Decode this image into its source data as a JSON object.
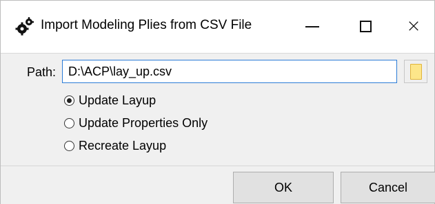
{
  "window": {
    "title": "Import Modeling Plies from CSV File",
    "app_icon": "gear-cluster-icon",
    "controls": {
      "minimize": "minimize-icon",
      "maximize": "maximize-icon",
      "close": "×"
    }
  },
  "path": {
    "label": "Path:",
    "value": "D:\\ACP\\lay_up.csv",
    "browse_icon": "folder-icon",
    "focus_color": "#2a7bd6"
  },
  "options": [
    {
      "label": "Update Layup",
      "selected": true
    },
    {
      "label": "Update Properties Only",
      "selected": false
    },
    {
      "label": "Recreate Layup",
      "selected": false
    }
  ],
  "buttons": {
    "ok": "OK",
    "cancel": "Cancel"
  },
  "colors": {
    "dialog_bg": "#f0f0f0",
    "button_bg": "#e1e1e1",
    "folder_fill": "#fde68a"
  }
}
